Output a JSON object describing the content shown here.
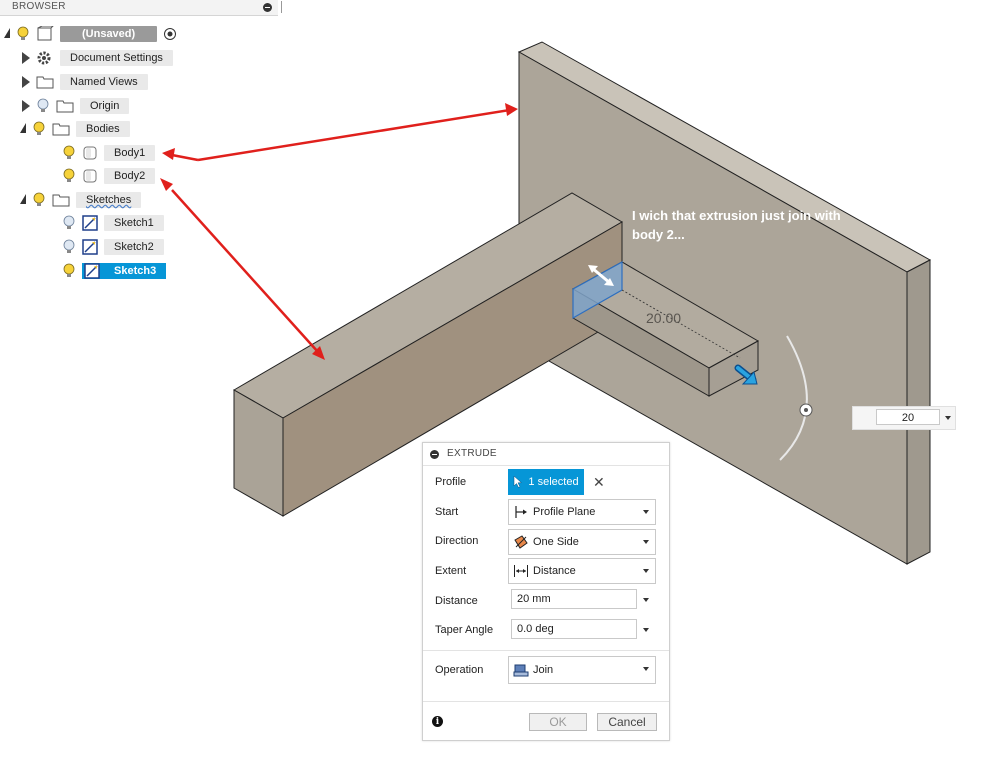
{
  "browser": {
    "title": "BROWSER",
    "root_label": "(Unsaved)",
    "items": {
      "document_settings": "Document Settings",
      "named_views": "Named Views",
      "origin": "Origin",
      "bodies": "Bodies",
      "body1": "Body1",
      "body2": "Body2",
      "sketches": "Sketches",
      "sketch1": "Sketch1",
      "sketch2": "Sketch2",
      "sketch3": "Sketch3"
    }
  },
  "canvas": {
    "annotation": "I wich that extrusion just join with body 2...",
    "dimension_label": "20.00",
    "distance_input_value": "20"
  },
  "extrude": {
    "title": "EXTRUDE",
    "profile_label": "Profile",
    "profile_value": "1 selected",
    "start_label": "Start",
    "start_value": "Profile Plane",
    "direction_label": "Direction",
    "direction_value": "One Side",
    "extent_label": "Extent",
    "extent_value": "Distance",
    "distance_label": "Distance",
    "distance_value": "20 mm",
    "taper_label": "Taper Angle",
    "taper_value": "0.0 deg",
    "operation_label": "Operation",
    "operation_value": "Join",
    "ok_label": "OK",
    "cancel_label": "Cancel"
  },
  "colors": {
    "accent": "#0696d7",
    "annotation_arrow": "#e0201c",
    "body_face": "#aca599"
  }
}
